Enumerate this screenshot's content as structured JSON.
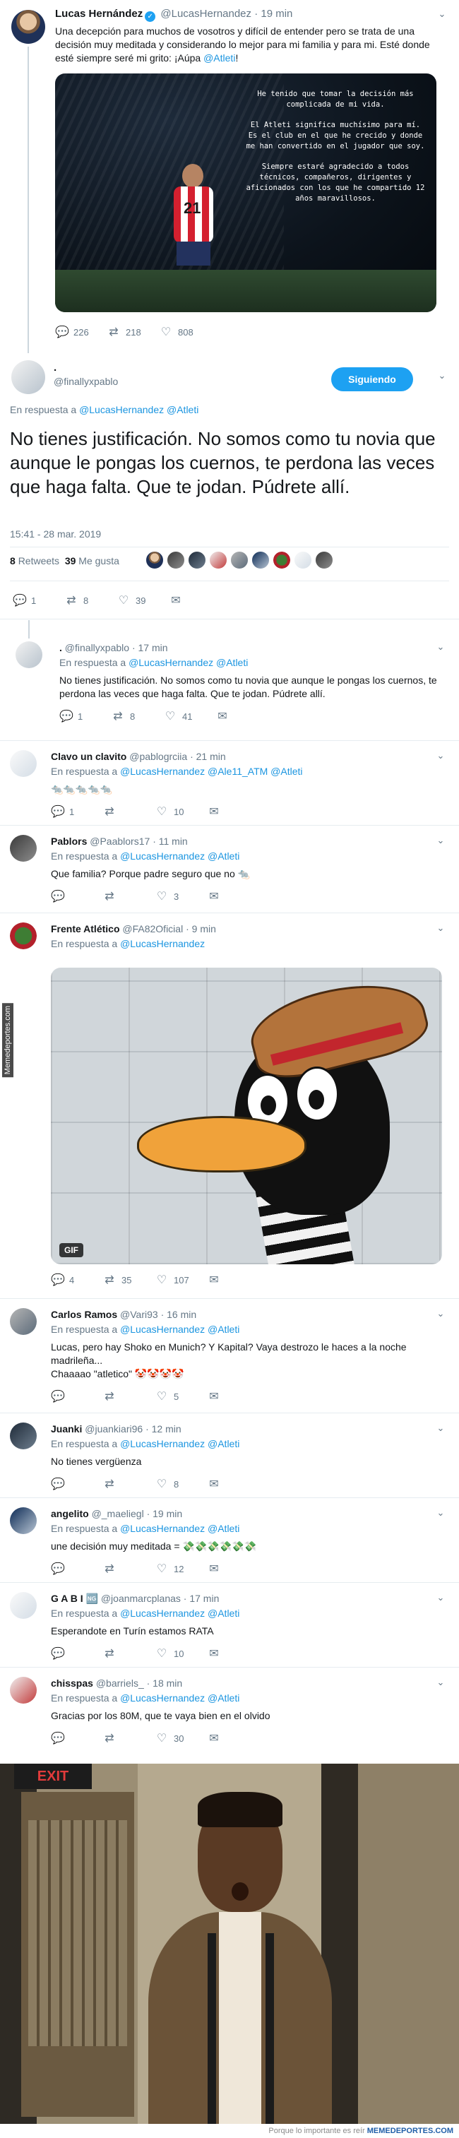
{
  "top_tweet": {
    "name": "Lucas Hernández",
    "handle": "@LucasHernandez",
    "time": "· 19 min",
    "text_before": "Una decepción para muchos de vosotros y difícil de entender pero se trata de una decisión muy meditada y considerando lo mejor para mi familia y para mi. Esté donde esté siempre seré mi grito: ¡Aúpa ",
    "text_link": "@Atleti",
    "text_after": "!",
    "image_quote": [
      "He tenido que tomar la decisión más complicada de mi vida.",
      "El Atleti significa muchísimo para mí. Es el club en el que he crecido y donde me han convertido en el jugador que soy.",
      "Siempre estaré agradecido a todos técnicos, compañeros, dirigentes y aficionados con los que he compartido 12 años maravillosos."
    ],
    "shirt_number": "21",
    "replies": "226",
    "retweets": "218",
    "likes": "808"
  },
  "main_tweet": {
    "name": ".",
    "handle": "@finallyxpablo",
    "follow_label": "Siguiendo",
    "reply_prefix": "En respuesta a ",
    "reply_to": "@LucasHernandez @Atleti",
    "text": "No tienes justificación. No somos como tu novia que aunque le pongas los cuernos, te perdona las veces que haga falta. Que te jodan. Púdrete allí.",
    "date": "15:41 - 28 mar. 2019",
    "retweet_count": "8",
    "retweet_label": "Retweets",
    "like_count": "39",
    "like_label": "Me gusta",
    "replies": "1",
    "retweets": "8",
    "likes": "39"
  },
  "replies": [
    {
      "name": ".",
      "handle": "@finallyxpablo",
      "time": "· 17 min",
      "to": "@LucasHernandez @Atleti",
      "text": "No tienes justificación. No somos como tu novia que aunque le pongas los cuernos, te perdona las veces que haga falta. Que te jodan. Púdrete allí.",
      "r": "1",
      "rt": "8",
      "l": "41"
    },
    {
      "name": "Clavo un clavito",
      "handle": "@pablogrciia",
      "time": "· 21 min",
      "to": "@LucasHernandez @Ale11_ATM @Atleti",
      "text": "🐀🐀🐀🐀🐀",
      "r": "1",
      "rt": "",
      "l": "10"
    },
    {
      "name": "Pablors",
      "handle": "@Paablors17",
      "time": "· 11 min",
      "to": "@LucasHernandez @Atleti",
      "text": "Que familia? Porque padre seguro que no 🐀",
      "r": "",
      "rt": "",
      "l": "3"
    },
    {
      "name": "Frente Atlético",
      "handle": "@FA82Oficial",
      "time": "· 9 min",
      "to": "@LucasHernandez",
      "text": "",
      "gif_label": "GIF",
      "r": "4",
      "rt": "35",
      "l": "107"
    },
    {
      "name": "Carlos Ramos",
      "handle": "@Vari93",
      "time": "· 16 min",
      "to": "@LucasHernandez @Atleti",
      "text": "Lucas, pero hay Shoko en Munich? Y Kapital? Vaya destrozo le haces a la noche madrileña...\nChaaaao \"atletico\" 🤡🤡🤡🤡",
      "r": "",
      "rt": "",
      "l": "5"
    },
    {
      "name": "Juanki",
      "handle": "@juankiari96",
      "time": "· 12 min",
      "to": "@LucasHernandez @Atleti",
      "text": "No tienes vergüenza",
      "r": "",
      "rt": "",
      "l": "8"
    },
    {
      "name": "angelito",
      "handle": "@_maeliegl",
      "time": "· 19 min",
      "to": "@LucasHernandez @Atleti",
      "text": "une decisión muy meditada = 💸💸💸💸💸💸",
      "r": "",
      "rt": "",
      "l": "12"
    },
    {
      "name": "G A B I 🆖",
      "handle": "@joanmarcplanas",
      "time": "· 17 min",
      "to": "@LucasHernandez @Atleti",
      "text": "Esperandote en Turín estamos RATA",
      "r": "",
      "rt": "",
      "l": "10"
    },
    {
      "name": "chisspas",
      "handle": "@barriels_",
      "time": "· 18 min",
      "to": "@LucasHernandez @Atleti",
      "text": "Gracias por los 80M, que te vaya bien en el olvido",
      "r": "",
      "rt": "",
      "l": "30"
    }
  ],
  "side_watermark": "Memedeportes.com",
  "photo_sign": "EXIT",
  "credit_text": "Porque lo importante es reír ",
  "credit_brand": "MEMEDEPORTES.COM",
  "colors": {
    "accent": "#1da1f2",
    "link": "#1b95e0",
    "muted": "#657786"
  }
}
